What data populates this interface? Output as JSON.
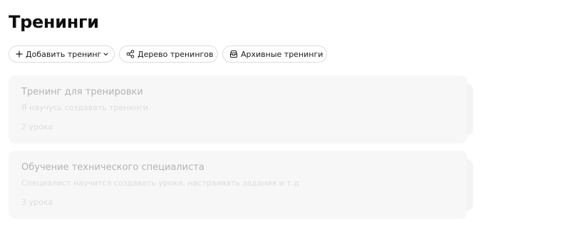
{
  "header": {
    "title": "Тренинги"
  },
  "toolbar": {
    "add_label": "Добавить тренинг",
    "add_icon": "plus-icon",
    "add_caret_icon": "chevron-down-icon",
    "tree_label": "Дерево тренингов",
    "tree_icon": "share-nodes-icon",
    "archive_label": "Архивные тренинги",
    "archive_icon": "archive-box-icon"
  },
  "trainings": [
    {
      "title": "Тренинг для тренировки",
      "description": "Я научусь создавать тренинги",
      "lessons": "2 урока"
    },
    {
      "title": "Обучение технического специалиста",
      "description": "Специалист научится создавать уроки, настраивать задания и т.д",
      "lessons": "3 урока"
    }
  ]
}
